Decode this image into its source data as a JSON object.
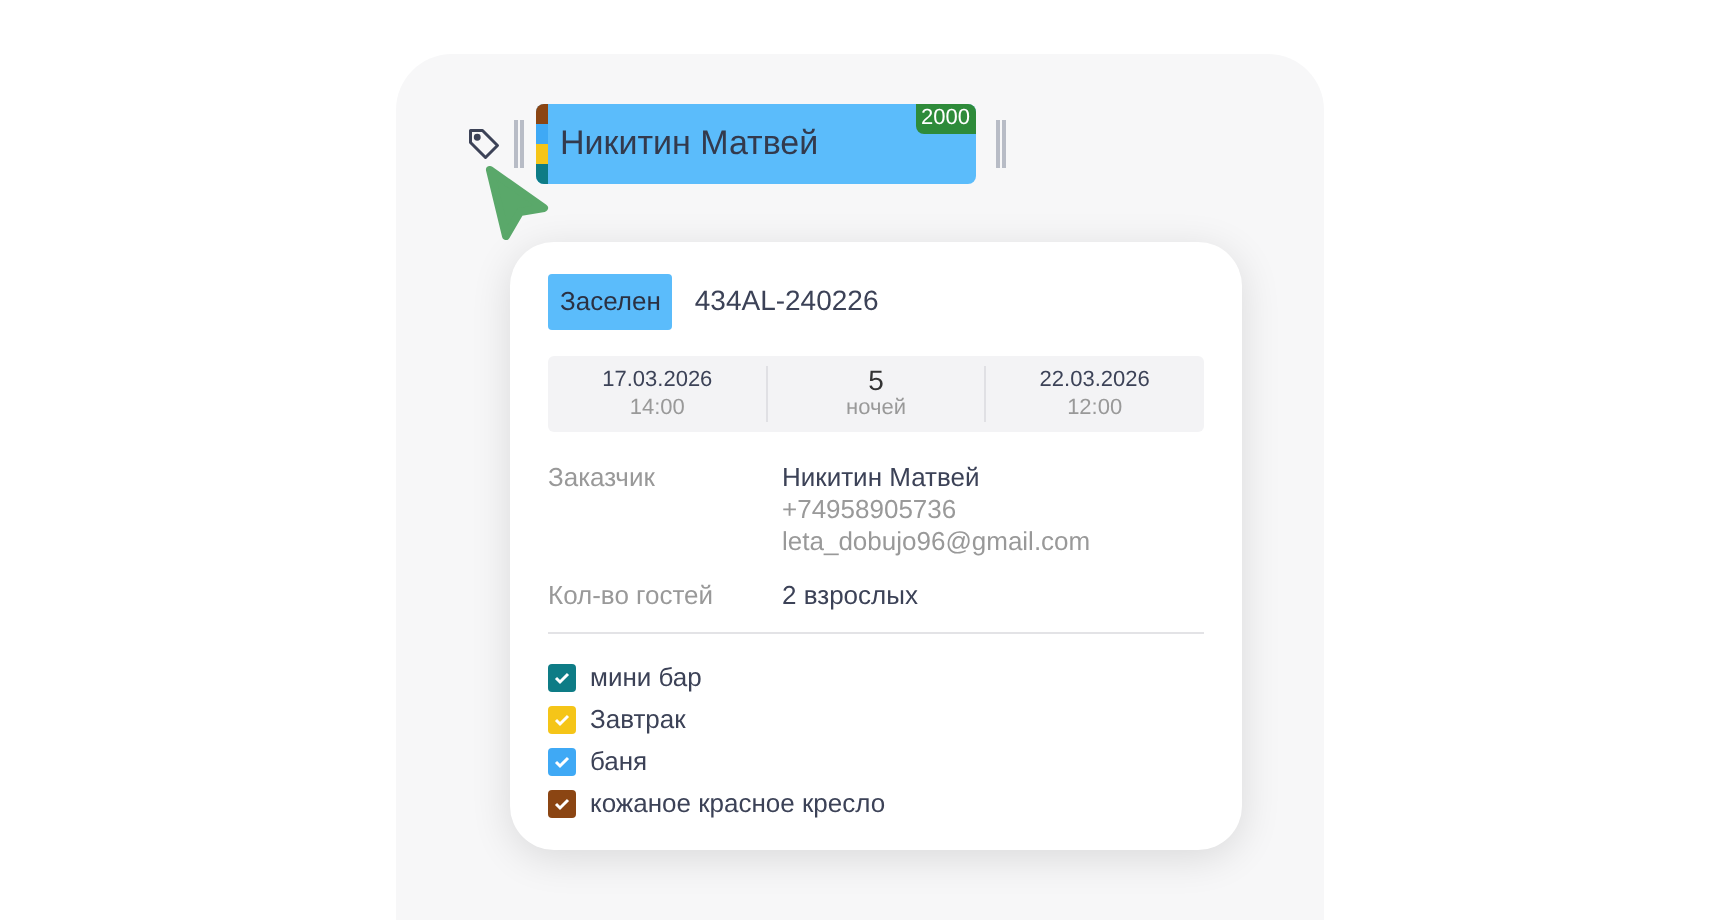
{
  "booking": {
    "guest": "Никитин Матвей",
    "badge": "2000"
  },
  "popup": {
    "status": "Заселен",
    "code": "434AL-240226",
    "checkin": {
      "date": "17.03.2026",
      "time": "14:00"
    },
    "nights": {
      "count": "5",
      "label": "ночей"
    },
    "checkout": {
      "date": "22.03.2026",
      "time": "12:00"
    },
    "customer": {
      "label": "Заказчик",
      "name": "Никитин Матвей",
      "phone": "+74958905736",
      "email": "leta_dobujo96@gmail.com"
    },
    "guests": {
      "label": "Кол-во гостей",
      "value": "2 взрослых"
    },
    "services": [
      {
        "name": "мини бар",
        "checked": true,
        "color": "#0e7c86"
      },
      {
        "name": "Завтрак",
        "checked": true,
        "color": "#f5c518"
      },
      {
        "name": "баня",
        "checked": true,
        "color": "#3fa9f5"
      },
      {
        "name": "кожаное красное кресло",
        "checked": true,
        "color": "#8b4513"
      }
    ]
  }
}
